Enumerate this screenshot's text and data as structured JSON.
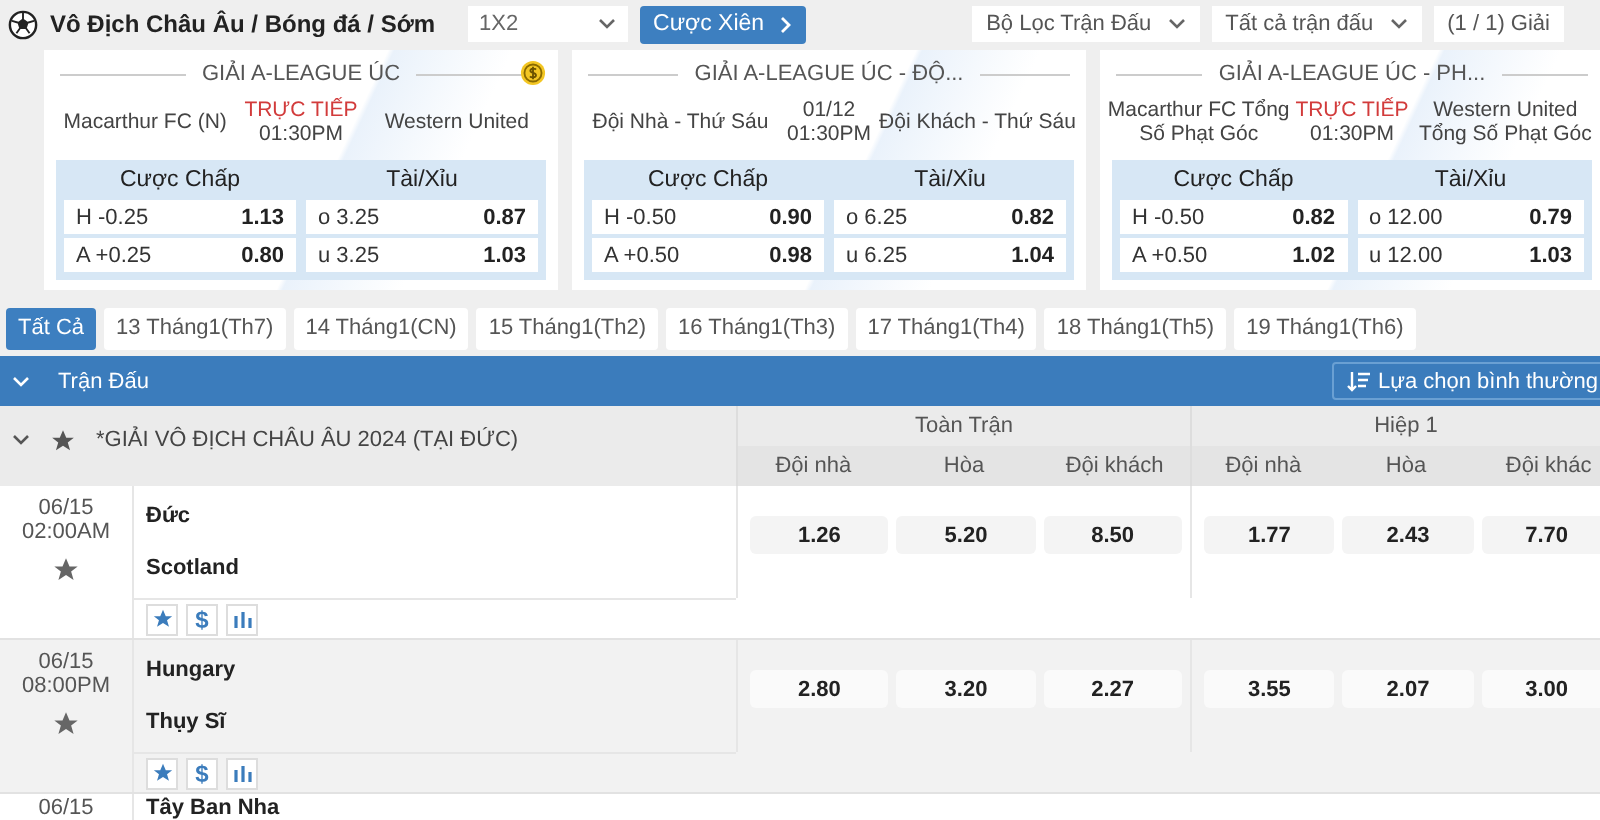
{
  "header": {
    "breadcrumb": "Vô Địch Châu Âu / Bóng đá / Sớm",
    "market": "1X2",
    "parlay_button": "Cược Xiên",
    "filters": [
      "Bộ Lọc Trận Đấu",
      "Tất cả trận đấu"
    ],
    "league_count": "(1 / 1) Giải"
  },
  "cards": [
    {
      "league": "GIẢI A-LEAGUE ÚC",
      "cashout": true,
      "home": "Macarthur FC (N)",
      "live": true,
      "status": "TRỰC TIẾP",
      "time": "01:30PM",
      "away": "Western United",
      "handicap_title": "Cược Chấp",
      "total_title": "Tài/Xỉu",
      "handicap": [
        {
          "line": "H -0.25",
          "odds": "1.13"
        },
        {
          "line": "A +0.25",
          "odds": "0.80"
        }
      ],
      "total": [
        {
          "line": "o 3.25",
          "odds": "0.87"
        },
        {
          "line": "u 3.25",
          "odds": "1.03"
        }
      ]
    },
    {
      "league": "GIẢI A-LEAGUE ÚC - ĐỘ...",
      "cashout": false,
      "home": "Đội Nhà - Thứ Sáu",
      "live": false,
      "status": "01/12",
      "time": "01:30PM",
      "away": "Đội Khách - Thứ Sáu",
      "handicap_title": "Cược Chấp",
      "total_title": "Tài/Xỉu",
      "handicap": [
        {
          "line": "H -0.50",
          "odds": "0.90"
        },
        {
          "line": "A +0.50",
          "odds": "0.98"
        }
      ],
      "total": [
        {
          "line": "o 6.25",
          "odds": "0.82"
        },
        {
          "line": "u 6.25",
          "odds": "1.04"
        }
      ]
    },
    {
      "league": "GIẢI A-LEAGUE ÚC - PH...",
      "cashout": false,
      "home": "Macarthur FC Tổng Số Phạt Góc",
      "live": true,
      "status": "TRỰC TIẾP",
      "time": "01:30PM",
      "away": "Western United Tổng Số Phạt Góc",
      "handicap_title": "Cược Chấp",
      "total_title": "Tài/Xỉu",
      "handicap": [
        {
          "line": "H -0.50",
          "odds": "0.82"
        },
        {
          "line": "A +0.50",
          "odds": "1.02"
        }
      ],
      "total": [
        {
          "line": "o 12.00",
          "odds": "0.79"
        },
        {
          "line": "u 12.00",
          "odds": "1.03"
        }
      ]
    }
  ],
  "date_tabs": [
    {
      "label": "Tất Cả",
      "selected": true
    },
    {
      "label": "13 Tháng1(Th7)",
      "selected": false
    },
    {
      "label": "14 Tháng1(CN)",
      "selected": false
    },
    {
      "label": "15 Tháng1(Th2)",
      "selected": false
    },
    {
      "label": "16 Tháng1(Th3)",
      "selected": false
    },
    {
      "label": "17 Tháng1(Th4)",
      "selected": false
    },
    {
      "label": "18 Tháng1(Th5)",
      "selected": false
    },
    {
      "label": "19 Tháng1(Th6)",
      "selected": false
    }
  ],
  "table": {
    "section": "Trận Đấu",
    "view_button": "Lựa chọn bình thường",
    "league": "*GIẢI VÔ ĐỊCH CHÂU ÂU 2024 (TẠI ĐỨC)",
    "groups": [
      {
        "title": "Toàn Trận",
        "columns": [
          "Đội nhà",
          "Hòa",
          "Đội khách"
        ]
      },
      {
        "title": "Hiệp 1",
        "columns": [
          "Đội nhà",
          "Hòa",
          "Đội khác"
        ]
      }
    ],
    "matches": [
      {
        "date": "06/15",
        "time": "02:00AM",
        "home": "Đức",
        "away": "Scotland",
        "money": "$",
        "odds": [
          "1.26",
          "5.20",
          "8.50",
          "1.77",
          "2.43",
          "7.70"
        ]
      },
      {
        "date": "06/15",
        "time": "08:00PM",
        "home": "Hungary",
        "away": "Thụy Sĩ",
        "money": "$",
        "odds": [
          "2.80",
          "3.20",
          "2.27",
          "3.55",
          "2.07",
          "3.00"
        ]
      },
      {
        "date": "06/15",
        "home": "Tây Ban Nha"
      }
    ]
  }
}
